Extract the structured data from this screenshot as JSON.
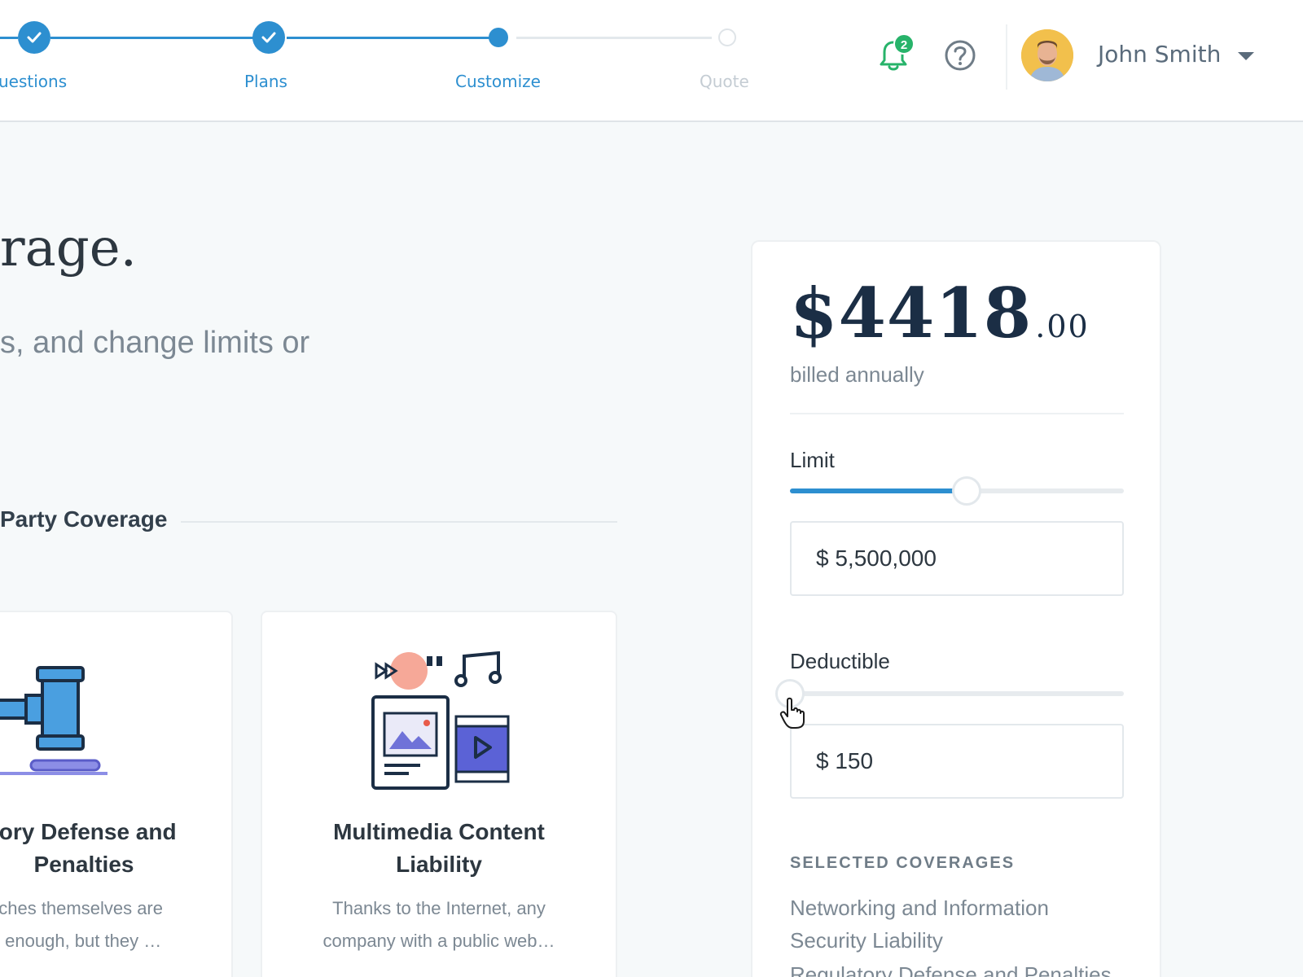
{
  "progress": {
    "steps": [
      {
        "label": "Questions",
        "state": "done"
      },
      {
        "label": "Plans",
        "state": "done"
      },
      {
        "label": "Customize",
        "state": "active"
      },
      {
        "label": "Quote",
        "state": "todo"
      }
    ],
    "partial_first_label": "uestions"
  },
  "header": {
    "notification_count": "2",
    "user_name": "John Smith",
    "icons": [
      "bell-icon",
      "help-icon",
      "avatar",
      "caret-down-icon"
    ]
  },
  "main": {
    "title": "rage.",
    "subtitle": "s, and change limits or",
    "section_title": "Party Coverage",
    "cards": [
      {
        "title_line1": "tory Defense and",
        "title_line2": "Penalties",
        "desc_line1": "aches themselves are",
        "desc_line2": "g enough, but they …",
        "icon": "gavel-icon"
      },
      {
        "title_line1": "Multimedia Content",
        "title_line2": "Liability",
        "desc_line1": "Thanks to the Internet, any",
        "desc_line2": "company with a public web…",
        "icon": "multimedia-icon"
      }
    ]
  },
  "summary": {
    "price_dollars": "$4418",
    "price_cents": ".00",
    "billing": "billed annually",
    "limit": {
      "label": "Limit",
      "value": "$ 5,500,000",
      "slider_fraction": 0.53
    },
    "deductible": {
      "label": "Deductible",
      "value": "$ 150",
      "slider_fraction": 0.0
    },
    "selected_heading": "SELECTED COVERAGES",
    "selected_items": [
      "Networking and Information Security Liability",
      "Regulatory Defense and Penalties"
    ]
  },
  "colors": {
    "accent": "#2d8fd0",
    "badge": "#27b36a",
    "navy": "#1b2e45",
    "muted": "#7c8893"
  }
}
